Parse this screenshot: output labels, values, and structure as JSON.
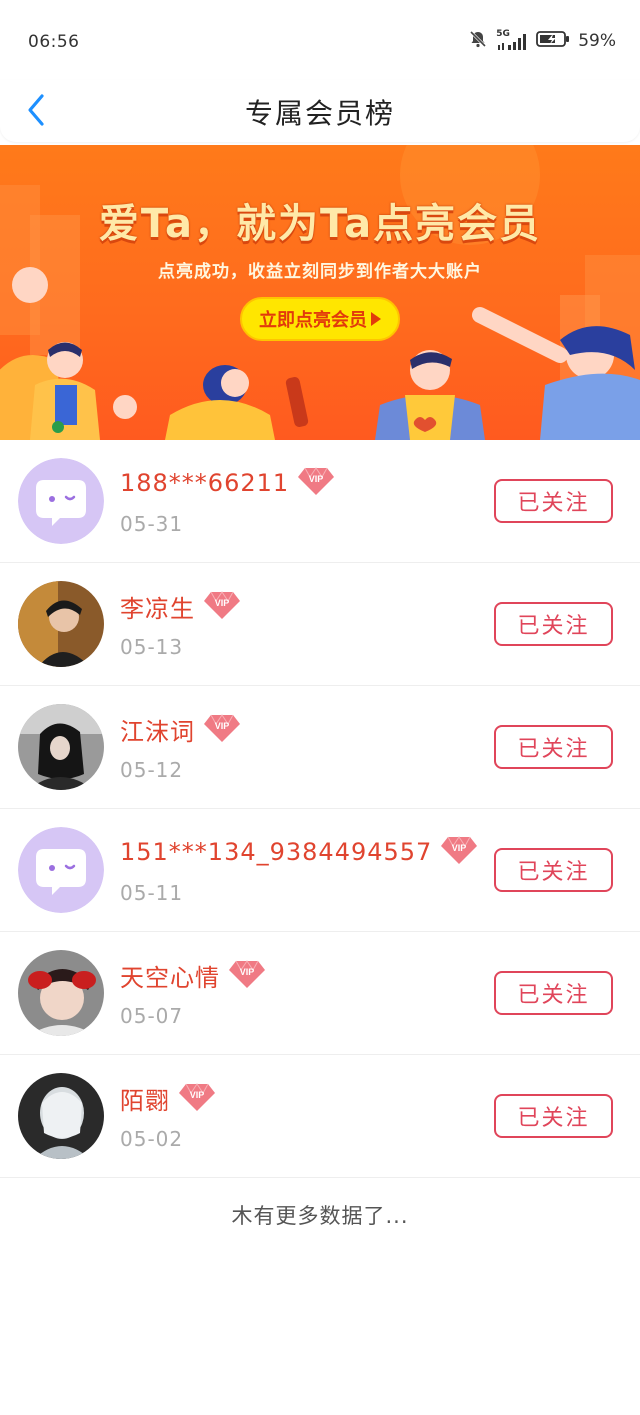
{
  "status_bar": {
    "time": "06:56",
    "network": "5G",
    "battery": "59%",
    "icons": [
      "mute-bell-icon",
      "signal-icon",
      "battery-icon"
    ]
  },
  "nav": {
    "title": "专属会员榜",
    "back_icon": "chevron-left-icon"
  },
  "banner": {
    "title": "爱Ta，就为Ta点亮会员",
    "subtitle": "点亮成功，收益立刻同步到作者大大账户",
    "cta": "立即点亮会员"
  },
  "colors": {
    "accent_red": "#e0442f",
    "button_border": "#e0455a",
    "banner_orange": "#ff6a1e",
    "cta_yellow": "#ffe600"
  },
  "members": [
    {
      "name": "188***66211",
      "date": "05-31",
      "button": "已关注",
      "avatar": "default-chat-avatar"
    },
    {
      "name": "李凉生",
      "date": "05-13",
      "button": "已关注",
      "avatar": "photo-avatar"
    },
    {
      "name": "江沫词",
      "date": "05-12",
      "button": "已关注",
      "avatar": "photo-avatar"
    },
    {
      "name": "151***134_9384494557",
      "date": "05-11",
      "button": "已关注",
      "avatar": "default-chat-avatar"
    },
    {
      "name": "天空心情",
      "date": "05-07",
      "button": "已关注",
      "avatar": "photo-avatar"
    },
    {
      "name": "陌翾",
      "date": "05-02",
      "button": "已关注",
      "avatar": "photo-avatar"
    }
  ],
  "vip_badge": "VIP",
  "footer": "木有更多数据了..."
}
